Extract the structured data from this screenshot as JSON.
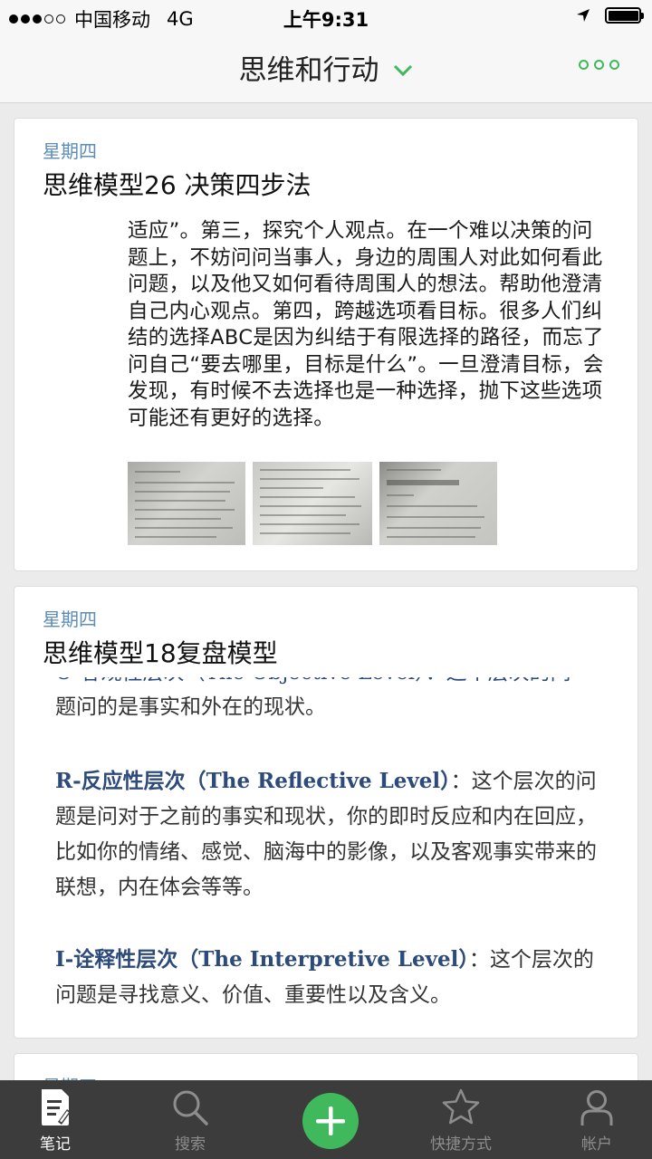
{
  "status_bar": {
    "carrier": "中国移动",
    "network": "4G",
    "time": "上午9:31"
  },
  "nav": {
    "title": "思维和行动"
  },
  "notes": [
    {
      "date": "星期四",
      "title": "思维模型26 决策四步法",
      "excerpt": "适应”。第三，探究个人观点。在一个难以决策的问题上，不妨问问当事人，身边的周围人对此如何看此问题，以及他又如何看待周围人的想法。帮助他澄清自己内心观点。第四，跨越选项看目标。很多人们纠结的选择ABC是因为纠结于有限选择的路径，而忘了问自己“要去哪里，目标是什么”。一旦澄清目标，会发现，有时候不去选择也是一种选择，抛下这些选项可能还有更好的选择。"
    },
    {
      "date": "星期四",
      "title": "思维模型18复盘模型",
      "clipped_line": "O-客观性层次（The Objective Level）：这个层次的问",
      "p0": "题问的是事实和外在的现状。",
      "p1_term": "R-反应性层次（The Reflective Level）",
      "p1_text": "：这个层次的问题是问对于之前的事实和现状，你的即时反应和内在回应，比如你的情绪、感觉、脑海中的影像，以及客观事实带来的联想，内在体会等等。",
      "p2_term": "I-诠释性层次（The Interpretive Level）",
      "p2_text": "：这个层次的问题是寻找意义、价值、重要性以及含义。"
    },
    {
      "date": "星期四"
    }
  ],
  "tabs": {
    "notes": "笔记",
    "search": "搜索",
    "shortcuts": "快捷方式",
    "account": "帐户"
  },
  "colors": {
    "accent": "#3fb95b",
    "date": "#5d8cb5",
    "tabbar": "#3c3c3c"
  }
}
